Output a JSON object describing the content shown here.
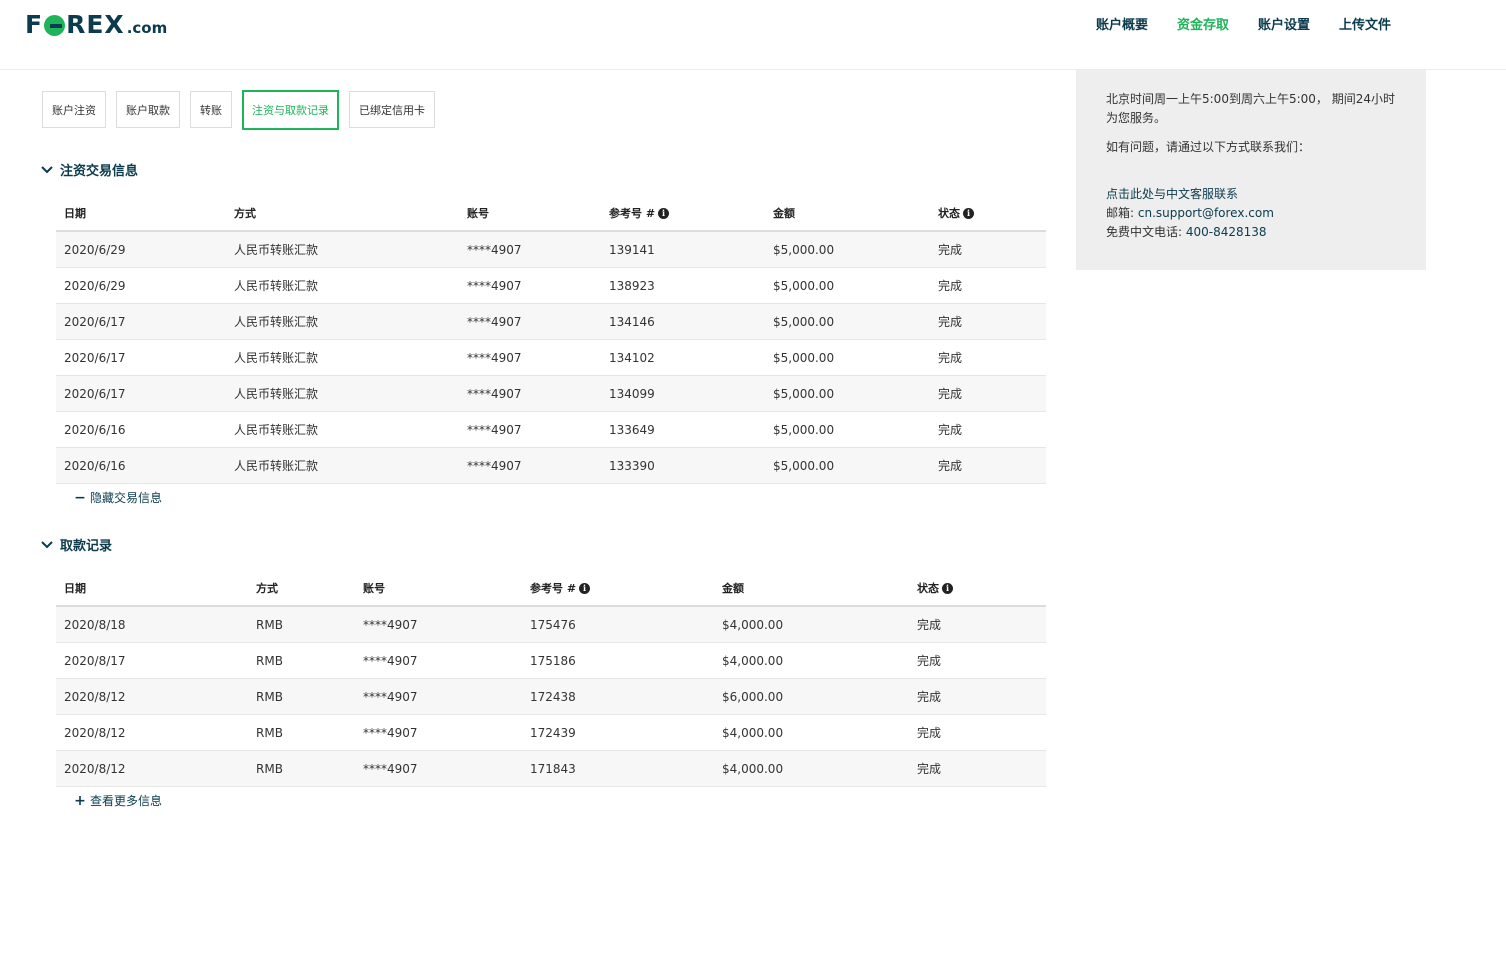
{
  "header": {
    "logo": {
      "main_left": "F",
      "main_right": "REX",
      "suffix": ".com"
    },
    "nav": [
      "账户概要",
      "资金存取",
      "账户设置",
      "上传文件"
    ],
    "active_nav": "资金存取"
  },
  "tabs": [
    "账户注资",
    "账户取款",
    "转账",
    "注资与取款记录",
    "已绑定信用卡"
  ],
  "active_tab": "注资与取款记录",
  "deposit": {
    "title": "注资交易信息",
    "headers": [
      "日期",
      "方式",
      "账号",
      "参考号 #",
      "金额",
      "状态"
    ],
    "rows": [
      [
        "2020/6/29",
        "人民币转账汇款",
        "****4907",
        "139141",
        "$5,000.00",
        "完成"
      ],
      [
        "2020/6/29",
        "人民币转账汇款",
        "****4907",
        "138923",
        "$5,000.00",
        "完成"
      ],
      [
        "2020/6/17",
        "人民币转账汇款",
        "****4907",
        "134146",
        "$5,000.00",
        "完成"
      ],
      [
        "2020/6/17",
        "人民币转账汇款",
        "****4907",
        "134102",
        "$5,000.00",
        "完成"
      ],
      [
        "2020/6/17",
        "人民币转账汇款",
        "****4907",
        "134099",
        "$5,000.00",
        "完成"
      ],
      [
        "2020/6/16",
        "人民币转账汇款",
        "****4907",
        "133649",
        "$5,000.00",
        "完成"
      ],
      [
        "2020/6/16",
        "人民币转账汇款",
        "****4907",
        "133390",
        "$5,000.00",
        "完成"
      ]
    ],
    "toggle_label": "隐藏交易信息"
  },
  "withdraw": {
    "title": "取款记录",
    "headers": [
      "日期",
      "方式",
      "账号",
      "参考号 #",
      "金额",
      "状态"
    ],
    "rows": [
      [
        "2020/8/18",
        "RMB",
        "****4907",
        "175476",
        "$4,000.00",
        "完成"
      ],
      [
        "2020/8/17",
        "RMB",
        "****4907",
        "175186",
        "$4,000.00",
        "完成"
      ],
      [
        "2020/8/12",
        "RMB",
        "****4907",
        "172438",
        "$6,000.00",
        "完成"
      ],
      [
        "2020/8/12",
        "RMB",
        "****4907",
        "172439",
        "$4,000.00",
        "完成"
      ],
      [
        "2020/8/12",
        "RMB",
        "****4907",
        "171843",
        "$4,000.00",
        "完成"
      ]
    ],
    "toggle_label": "查看更多信息"
  },
  "sidebar": {
    "hours": "北京时间周一上午5:00到周六上午5:00， 期间24小时为您服务。",
    "contact_intro": "如有问题，请通过以下方式联系我们：",
    "chat_link": "点击此处与中文客服联系",
    "email_label": "邮箱: ",
    "email": "cn.support@forex.com",
    "phone_label": "免费中文电话: ",
    "phone": "400-8428138"
  },
  "colors": {
    "brand_green": "#1db45a",
    "brand_navy": "#0b3b4c"
  },
  "icons": {
    "section_toggle": "chevron-down-icon",
    "info": "info-circle-icon",
    "collapse": "minus-icon",
    "expand": "plus-icon"
  }
}
